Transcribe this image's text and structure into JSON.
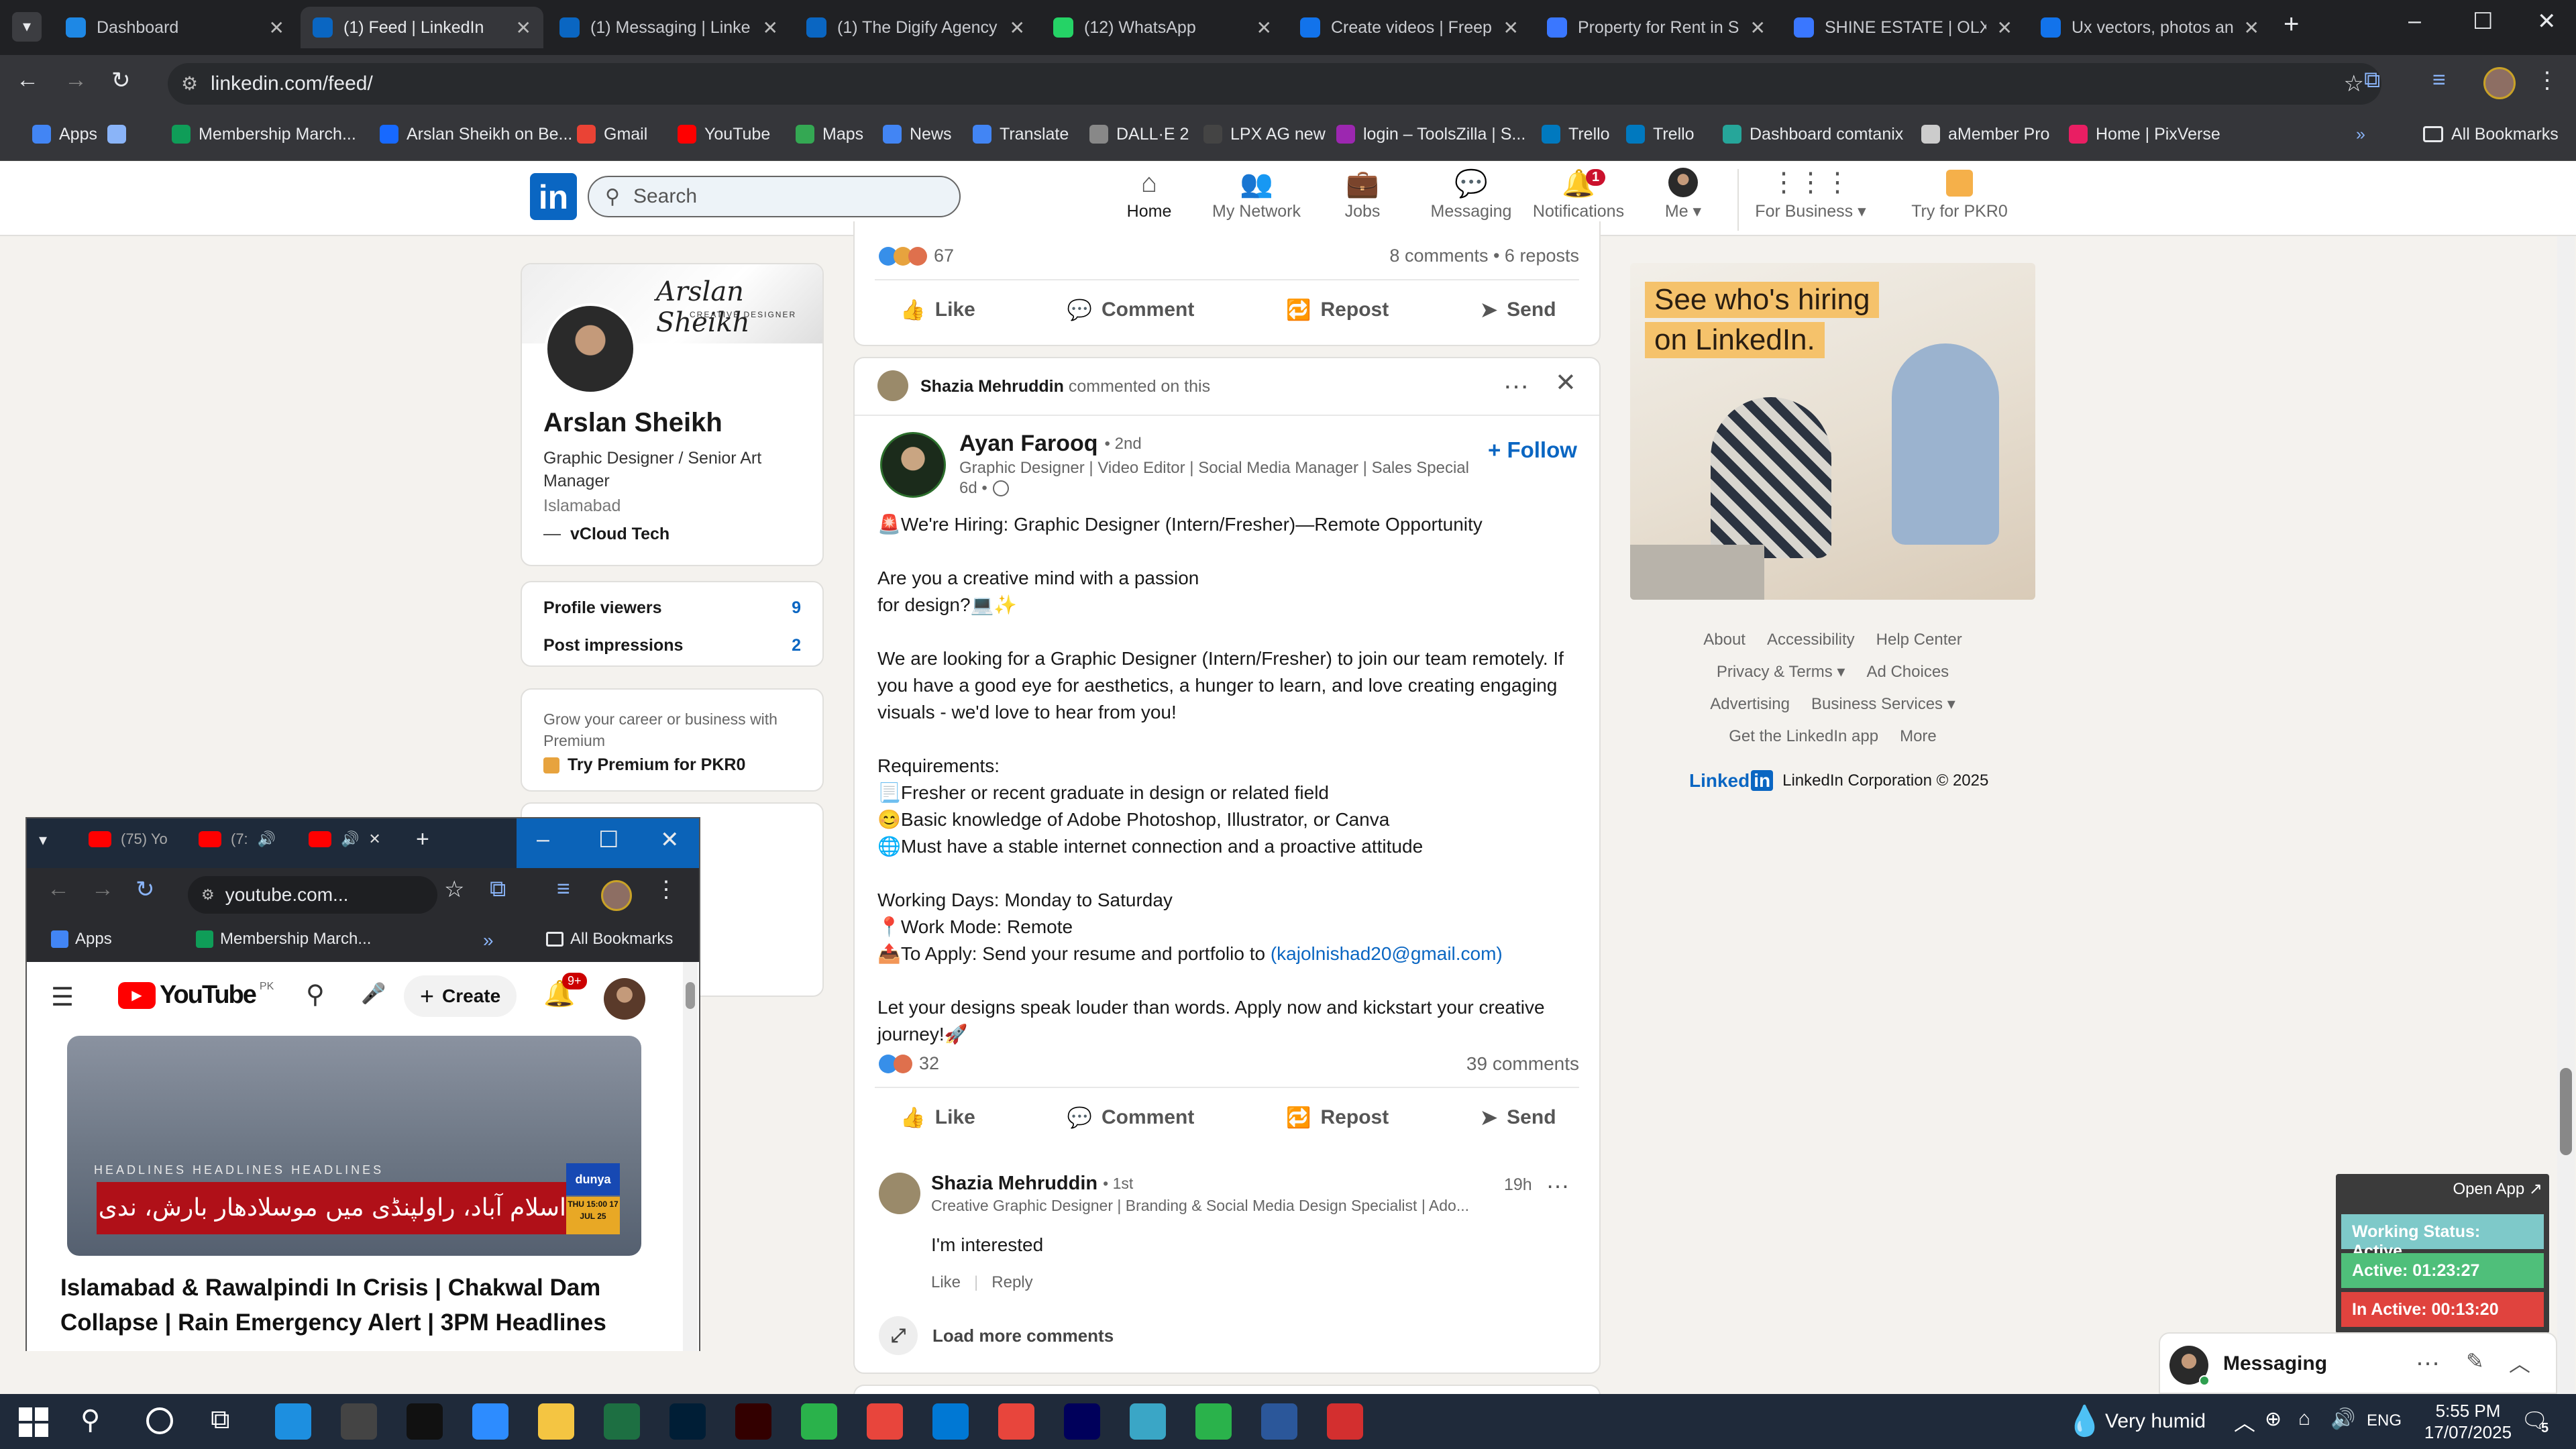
{
  "browser": {
    "tabs": [
      {
        "title": "Dashboard",
        "color": "#1e88e5",
        "active": false
      },
      {
        "title": "(1) Feed | LinkedIn",
        "color": "#0a66c2",
        "active": true
      },
      {
        "title": "(1) Messaging | Linke",
        "color": "#0a66c2",
        "active": false
      },
      {
        "title": "(1) The Digify Agency",
        "color": "#0a66c2",
        "active": false
      },
      {
        "title": "(12) WhatsApp",
        "color": "#25d366",
        "active": false
      },
      {
        "title": "Create videos | Freep",
        "color": "#1273eb",
        "active": false
      },
      {
        "title": "Property for Rent in S",
        "color": "#3a77ff",
        "active": false
      },
      {
        "title": "SHINE ESTATE | OLX",
        "color": "#3a77ff",
        "active": false
      },
      {
        "title": "Ux vectors, photos an",
        "color": "#1273eb",
        "active": false
      }
    ],
    "url": "linkedin.com/feed/",
    "bookmarks": [
      {
        "label": "Apps",
        "color": "#4285f4"
      },
      {
        "label": "",
        "color": "#8ab4f8"
      },
      {
        "label": "Membership March...",
        "color": "#0f9d58"
      },
      {
        "label": "Arslan Sheikh on Be...",
        "color": "#1769ff"
      },
      {
        "label": "Gmail",
        "color": "#ea4335"
      },
      {
        "label": "YouTube",
        "color": "#ff0000"
      },
      {
        "label": "Maps",
        "color": "#34a853"
      },
      {
        "label": "News",
        "color": "#4285f4"
      },
      {
        "label": "Translate",
        "color": "#4285f4"
      },
      {
        "label": "DALL·E 2",
        "color": "#888888"
      },
      {
        "label": "LPX AG new",
        "color": "#444444"
      },
      {
        "label": "login – ToolsZilla | S...",
        "color": "#9c27b0"
      },
      {
        "label": "Trello",
        "color": "#0079bf"
      },
      {
        "label": "Trello",
        "color": "#0079bf"
      },
      {
        "label": "Dashboard comtanix",
        "color": "#26a69a"
      },
      {
        "label": "aMember Pro",
        "color": "#cccccc"
      },
      {
        "label": "Home | PixVerse",
        "color": "#e91e63"
      }
    ],
    "all_bookmarks": "All Bookmarks"
  },
  "linkedin": {
    "search_placeholder": "Search",
    "nav": [
      {
        "label": "Home",
        "icon": "home-icon",
        "badge": ""
      },
      {
        "label": "My Network",
        "icon": "network-icon",
        "badge": ""
      },
      {
        "label": "Jobs",
        "icon": "jobs-icon",
        "badge": ""
      },
      {
        "label": "Messaging",
        "icon": "messaging-icon",
        "badge": ""
      },
      {
        "label": "Notifications",
        "icon": "bell-icon",
        "badge": "1"
      },
      {
        "label": "Me ▾",
        "icon": "avatar",
        "badge": ""
      },
      {
        "label": "For Business ▾",
        "icon": "grid-icon",
        "badge": ""
      },
      {
        "label": "Try for PKR0",
        "icon": "premium-icon",
        "badge": ""
      }
    ],
    "profile": {
      "banner_text": "Arslan Sheikh",
      "banner_subtext": "CREATIVE DESIGNER",
      "name": "Arslan Sheikh",
      "headline": "Graphic Designer / Senior Art Manager",
      "location": "Islamabad",
      "company": "vCloud Tech",
      "stats": [
        {
          "label": "Profile viewers",
          "value": "9"
        },
        {
          "label": "Post impressions",
          "value": "2"
        }
      ],
      "premium_text": "Grow your career or business with Premium",
      "premium_link": "Try Premium for PKR0"
    },
    "prev_post": {
      "reactions": "67",
      "stats": "8 comments • 6 reposts"
    },
    "actions": [
      "Like",
      "Comment",
      "Repost",
      "Send"
    ],
    "post": {
      "context_name": "Shazia Mehruddin",
      "context_text": "commented on this",
      "author": "Ayan Farooq",
      "degree": "• 2nd",
      "author_headline": "Graphic Designer | Video Editor | Social Media Manager | Sales Specialist",
      "time": "6d •",
      "follow": "+ Follow",
      "lines": [
        "🚨We're Hiring: Graphic Designer (Intern/Fresher)—Remote Opportunity",
        "",
        "Are you a creative mind with a passion",
        "for design?💻✨",
        "",
        "We are looking for a Graphic Designer (Intern/Fresher) to join our team remotely. If",
        "you have a good eye for aesthetics, a hunger to learn, and love creating engaging",
        "visuals - we'd love to hear from you!",
        "",
        "Requirements:",
        "📃Fresher or recent graduate in design or related field",
        "😊Basic knowledge of Adobe Photoshop, Illustrator, or Canva",
        "🌐Must have a stable internet connection and a proactive attitude",
        "",
        "Working Days: Monday to Saturday",
        "📍Work Mode: Remote",
        "📤To Apply: Send your resume and portfolio to "
      ],
      "email": "(kajolnishad20@gmail.com)",
      "closing_lines": [
        "Let your designs speak louder than words. Apply now and kickstart your creative",
        "journey!🚀"
      ],
      "reactions": "32",
      "comments_count": "39 comments"
    },
    "comment": {
      "author": "Shazia Mehruddin",
      "degree": "• 1st",
      "headline": "Creative Graphic Designer | Branding & Social Media Design Specialist | Ado...",
      "time": "19h",
      "text": "I'm interested",
      "like": "Like",
      "reply": "Reply",
      "load_more": "Load more comments"
    },
    "ad": {
      "line1": "See who's hiring",
      "line2": "on LinkedIn."
    },
    "footer": {
      "rows": [
        [
          "About",
          "Accessibility",
          "Help Center"
        ],
        [
          "Privacy & Terms ▾",
          "Ad Choices"
        ],
        [
          "Advertising",
          "Business Services ▾"
        ],
        [
          "Get the LinkedIn app",
          "More"
        ]
      ],
      "brand": "Linked",
      "brand_in": "in",
      "copyright": "LinkedIn Corporation © 2025"
    },
    "messaging": {
      "label": "Messaging"
    }
  },
  "tracker": {
    "open_app": "Open App ↗",
    "status": "Working Status: Active",
    "active": "Active: 01:23:27",
    "inactive": "In Active: 00:13:20"
  },
  "youtube_window": {
    "tabs": [
      "(75) Yo",
      "(7:",
      ""
    ],
    "url": "youtube.com...",
    "bookmarks": [
      "Apps",
      "Membership March...",
      "All Bookmarks"
    ],
    "logo": "YouTube",
    "region": "PK",
    "create": "Create",
    "notif_badge": "9+",
    "ticker": "HEADLINES  HEADLINES  HEADLINES",
    "urdu_headline": "اسلام آباد، راولپنڈی میں موسلادھار بارش، ندی نالے بپھر گئے",
    "channel": "dunya",
    "time_badge": "THU 15:00 17 JUL 25",
    "video_title": "Islamabad & Rawalpindi In Crisis | Chakwal Dam Collapse | Rain Emergency Alert | 3PM Headlines"
  },
  "taskbar": {
    "weather": "Very humid",
    "lang": "ENG",
    "time": "5:55 PM",
    "date": "17/07/2025",
    "notif_count": "5"
  }
}
